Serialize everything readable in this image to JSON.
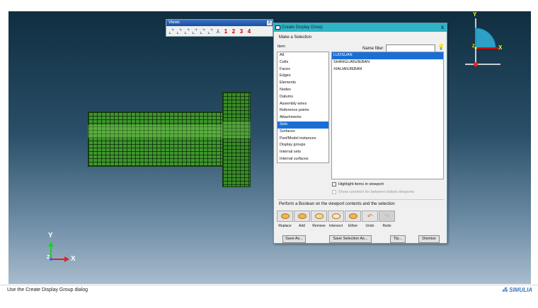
{
  "views_toolbar": {
    "title": "Views",
    "close": "x",
    "buttons": [
      "⌞⌝",
      "⌞⌝",
      "⌞⌝",
      "⌞⌝",
      "⌞⌝",
      "⌞⌝",
      "⅄"
    ],
    "numbers": [
      "1",
      "2",
      "3",
      "4"
    ]
  },
  "dialog": {
    "title": "Create Display Group",
    "close": "x",
    "make_selection": "Make a Selection",
    "item_header": "Item",
    "name_filter_label": "Name filter:",
    "name_filter_value": "",
    "items": [
      "All",
      "Cells",
      "Faces",
      "Edges",
      "Elements",
      "Nodes",
      "Datums",
      "Assembly wires",
      "Reference points",
      "Attachments",
      "Sets",
      "Surfaces",
      "Part/Model instances",
      "Display groups",
      "Internal sets",
      "Internal surfaces"
    ],
    "selected_item": "Sets",
    "sets": [
      "LUOSUAN",
      "SHANGLIANJIEBAN",
      "XIALIANJIEBAN"
    ],
    "selected_set": "LUOSUAN",
    "highlight_label": "Highlight items in viewport",
    "show_common_label": "Show common for between linked viewports",
    "boolean_label": "Perform a Boolean on the viewport contents and the selection",
    "bool_ops": [
      "Replace",
      "Add",
      "Remove",
      "Intersect",
      "Either",
      "Undo",
      "Redo"
    ],
    "buttons": {
      "save_as": "Save As...",
      "save_selection_as": "Save Selection As...",
      "tip": "Tip...",
      "dismiss": "Dismiss"
    }
  },
  "axes": {
    "triad_y": "Y",
    "triad_x": "X",
    "triad_z": "Z",
    "top_y": "Y",
    "top_x": "X",
    "top_z": "Z"
  },
  "status": {
    "text": "Use the Create Display Group dialog",
    "brand": "SIMULIA"
  },
  "colors": {
    "accent": "#1a6fd6",
    "dialog_title": "#2fb3c5",
    "mesh": "#3d8f2b"
  }
}
